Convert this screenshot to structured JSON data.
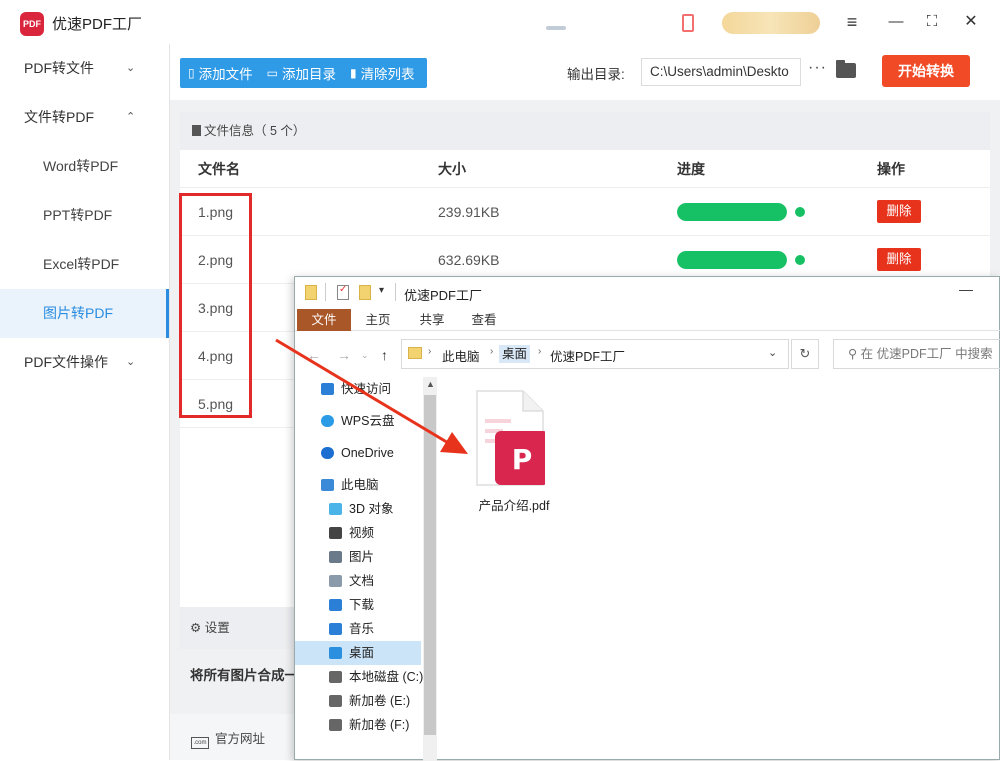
{
  "app": {
    "title": "优速PDF工厂",
    "logo_text": "PDF"
  },
  "titlebar": {
    "menu_icon": "≡",
    "min_icon": "—",
    "max_icon": "⛶",
    "close_icon": "✕"
  },
  "sidebar": {
    "items": [
      {
        "label": "PDF转文件",
        "type": "top",
        "chevron": "⌄"
      },
      {
        "label": "文件转PDF",
        "type": "top",
        "chevron": "⌃"
      },
      {
        "label": "Word转PDF",
        "type": "sub"
      },
      {
        "label": "PPT转PDF",
        "type": "sub"
      },
      {
        "label": "Excel转PDF",
        "type": "sub"
      },
      {
        "label": "图片转PDF",
        "type": "sub",
        "active": true
      },
      {
        "label": "PDF文件操作",
        "type": "top",
        "chevron": "⌄"
      }
    ]
  },
  "toolbar": {
    "add_file": "添加文件",
    "add_dir": "添加目录",
    "clear_list": "清除列表",
    "output_label": "输出目录:",
    "output_path": "C:\\Users\\admin\\Deskto",
    "more": "···",
    "start": "开始转换"
  },
  "file_list": {
    "info_label": "文件信息（ 5 个）",
    "headers": {
      "name": "文件名",
      "size": "大小",
      "progress": "进度",
      "action": "操作"
    },
    "rows": [
      {
        "name": "1.png",
        "size": "239.91KB",
        "progress": 1.0,
        "action": "删除"
      },
      {
        "name": "2.png",
        "size": "632.69KB",
        "progress": 1.0,
        "action": "删除"
      },
      {
        "name": "3.png",
        "size": "",
        "progress": null,
        "action": ""
      },
      {
        "name": "4.png",
        "size": "",
        "progress": null,
        "action": ""
      },
      {
        "name": "5.png",
        "size": "",
        "progress": null,
        "action": ""
      }
    ]
  },
  "settings": {
    "label": "设置",
    "merge_text": "将所有图片合成一"
  },
  "footer": {
    "website": "官方网址",
    "com_icon": ".com"
  },
  "explorer": {
    "title": "优速PDF工厂",
    "ribbon_tabs": [
      "文件",
      "主页",
      "共享",
      "查看"
    ],
    "breadcrumbs": [
      "此电脑",
      "桌面",
      "优速PDF工厂"
    ],
    "search_placeholder": "在 优速PDF工厂 中搜索",
    "nav_items": [
      {
        "label": "快速访问",
        "icon": "star-icon"
      },
      {
        "label": "WPS云盘",
        "icon": "cloud-icon"
      },
      {
        "label": "OneDrive",
        "icon": "onedrive-icon"
      },
      {
        "label": "此电脑",
        "icon": "computer-icon"
      },
      {
        "label": "3D 对象",
        "icon": "cube-icon"
      },
      {
        "label": "视频",
        "icon": "video-icon"
      },
      {
        "label": "图片",
        "icon": "picture-icon"
      },
      {
        "label": "文档",
        "icon": "document-icon"
      },
      {
        "label": "下载",
        "icon": "download-icon"
      },
      {
        "label": "音乐",
        "icon": "music-icon"
      },
      {
        "label": "桌面",
        "icon": "desktop-icon",
        "selected": true
      },
      {
        "label": "本地磁盘 (C:)",
        "icon": "drive-icon"
      },
      {
        "label": "新加卷 (E:)",
        "icon": "drive-icon"
      },
      {
        "label": "新加卷 (F:)",
        "icon": "drive-icon"
      }
    ],
    "file": {
      "name": "产品介绍.pdf"
    }
  },
  "colors": {
    "accent": "#2f9ae6",
    "start": "#f14a27",
    "delete": "#e8331c",
    "progress": "#16c065",
    "highlight": "#e22a2a",
    "pdf_brand": "#d9264f"
  }
}
